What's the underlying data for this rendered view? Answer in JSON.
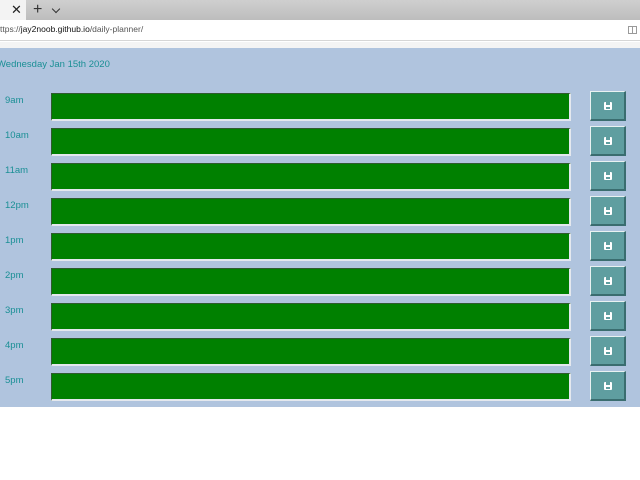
{
  "browser": {
    "url_prefix": "ttps://",
    "url_host": "jay2noob.github.io",
    "url_path": "/daily-planner/"
  },
  "planner": {
    "date": "Wednesday Jan 15th 2020",
    "hours": [
      "9am",
      "10am",
      "11am",
      "12pm",
      "1pm",
      "2pm",
      "3pm",
      "4pm",
      "5pm"
    ],
    "block_color": "#008000",
    "button_color": "#5f9ea0",
    "save_icon": "floppy-disk-icon"
  }
}
